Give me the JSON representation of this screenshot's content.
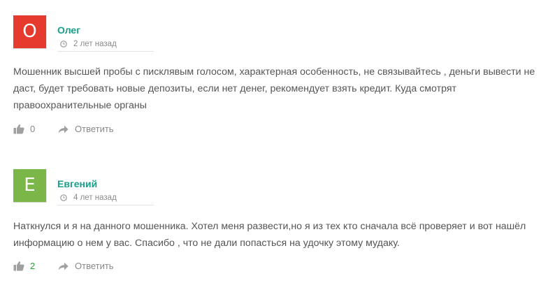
{
  "comments": [
    {
      "avatar_letter": "O",
      "avatar_color": "#e63a2e",
      "author": "Олег",
      "time": "2 лет назад",
      "text": "Мошенник высшей пробы с писклявым голосом, характерная особенность, не связывайтесь , деньги вывести не даст, будет требовать новые депозиты, если нет денег, рекомендует взять кредит. Куда смотрят правоохранительные органы",
      "likes": "0",
      "reply_label": "Ответить"
    },
    {
      "avatar_letter": "E",
      "avatar_color": "#7ab648",
      "author": "Евгений",
      "time": "4 лет назад",
      "text": "Наткнулся и я на данного мошенника. Хотел меня развести,но я из тех кто сначала всё проверяет и вот нашёл информацию о нем у вас. Спасибо , что не дали попасться на удочку этому мудаку.",
      "likes": "2",
      "reply_label": "Ответить"
    }
  ],
  "colors": {
    "author": "#17a08a",
    "text": "#555555",
    "meta": "#8a8a8a",
    "positive_count": "#2e9e3e"
  },
  "icons": {
    "time": "clock-icon",
    "like": "thumbs-up-icon",
    "reply": "reply-arrow-icon"
  }
}
